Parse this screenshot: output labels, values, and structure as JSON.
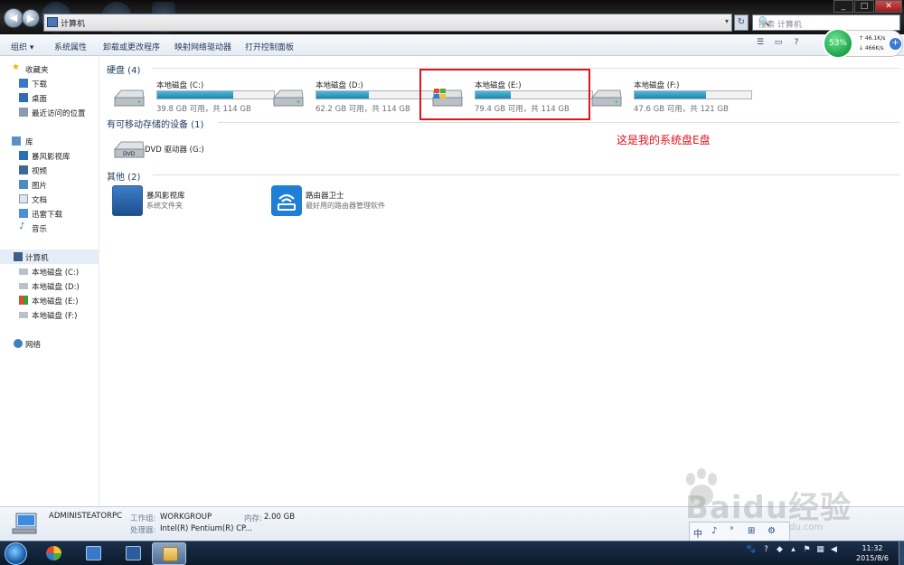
{
  "titlebar": {
    "breadcrumb": "计算机",
    "search_placeholder": "搜索 计算机",
    "dropdown_glyph": "▾",
    "refresh_glyph": "↻",
    "search_glyph": "🔍"
  },
  "toolbar": {
    "organize": "组织 ▾",
    "system_properties": "系统属性",
    "uninstall": "卸载或更改程序",
    "map_drive": "映射网络驱动器",
    "control_panel": "打开控制面板"
  },
  "net_widget": {
    "percent": "53%",
    "upload": "↑ 46.1K/s",
    "download": "↓ 466K/s",
    "plus": "+"
  },
  "sidebar": {
    "favorites": {
      "title": "收藏夹",
      "items": [
        "下载",
        "桌面",
        "最近访问的位置"
      ]
    },
    "libraries": {
      "title": "库",
      "items": [
        "暴风影视库",
        "视频",
        "图片",
        "文档",
        "迅雷下载",
        "音乐"
      ]
    },
    "computer": {
      "title": "计算机",
      "items": [
        "本地磁盘 (C:)",
        "本地磁盘 (D:)",
        "本地磁盘 (E:)",
        "本地磁盘 (F:)"
      ]
    },
    "network": {
      "title": "网络"
    }
  },
  "groups": {
    "hard_disks": "硬盘 (4)",
    "removable": "有可移动存储的设备 (1)",
    "other": "其他 (2)"
  },
  "drives": [
    {
      "name": "本地磁盘 (C:)",
      "info": "39.8 GB 可用，共 114 GB",
      "used_fraction": 0.65
    },
    {
      "name": "本地磁盘 (D:)",
      "info": "62.2 GB 可用，共 114 GB",
      "used_fraction": 0.45
    },
    {
      "name": "本地磁盘 (E:)",
      "info": "79.4 GB 可用，共 114 GB",
      "used_fraction": 0.3
    },
    {
      "name": "本地磁盘 (F:)",
      "info": "47.6 GB 可用，共 121 GB",
      "used_fraction": 0.61
    }
  ],
  "removable_device": {
    "name": "DVD 驱动器 (G:)"
  },
  "other_items": [
    {
      "name": "暴风影视库",
      "subtitle": "系统文件夹"
    },
    {
      "name": "路由器卫士",
      "subtitle": "最好用的路由器管理软件"
    }
  ],
  "annotation": "这是我的系统盘E盘",
  "details": {
    "computer_name": "ADMINISTEATORPC",
    "workgroup_label": "工作组:",
    "workgroup": "WORKGROUP",
    "memory_label": "内存:",
    "memory": "2.00 GB",
    "processor_label": "处理器:",
    "processor": "Intel(R) Pentium(R) CP..."
  },
  "watermark": {
    "brand": "Baidu经验",
    "url": "jingyan.baidu.com"
  },
  "ime_bar": [
    "中",
    "♪",
    "°",
    "⊞",
    "⚙"
  ],
  "taskbar": {
    "time": "11:32",
    "date": "2015/8/6"
  },
  "colors": {
    "accent_red": "#e0141b",
    "disk_fill": "#1d85ad",
    "taskbar": "#1b2f4a"
  }
}
